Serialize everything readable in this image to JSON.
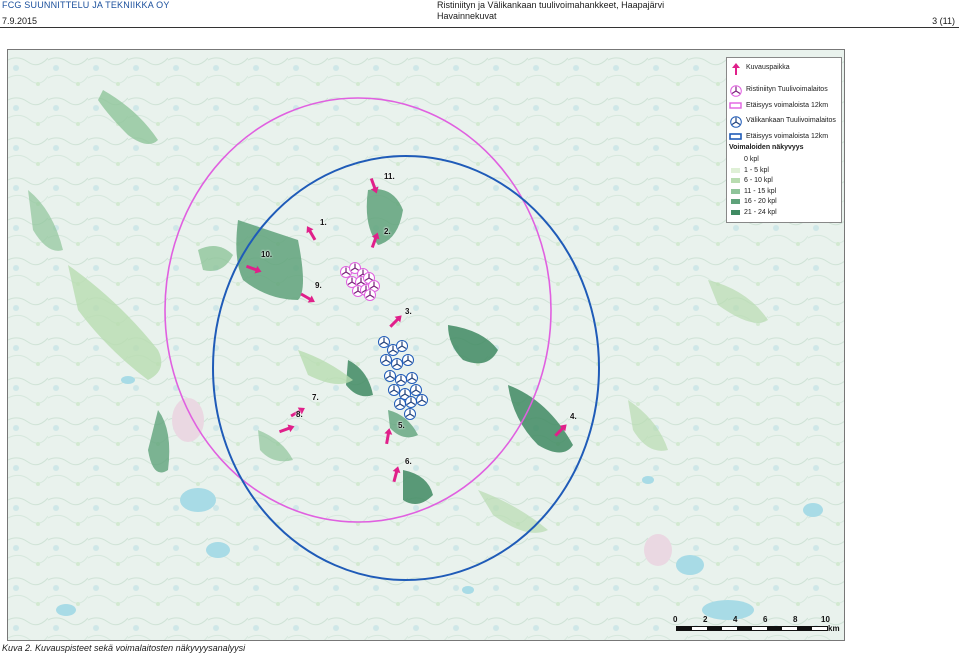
{
  "header": {
    "company": "FCG SUUNNITTELU JA TEKNIIKKA OY",
    "date": "7.9.2015",
    "title_line1": "Ristiniityn ja Välikankaan tuulivoimahankkeet, Haapajärvi",
    "title_line2": "Havainnekuvat",
    "page": "3 (11)"
  },
  "legend": {
    "photo_point": "Kuvauspaikka",
    "ristiniitty_turbine": "Ristiniityn Tuulivoimalaitos",
    "ristiniitty_distance": "Etäisyys voimaloista 12km",
    "valikangas_turbine": "Välikankaan Tuulivoimalaitos",
    "valikangas_distance": "Etäisyys voimaloista 12km",
    "visibility_title": "Voimaloiden näkyvyys",
    "classes": [
      {
        "label": "0 kpl",
        "color": "#ffffff"
      },
      {
        "label": "1 - 5 kpl",
        "color": "#dff0d6"
      },
      {
        "label": "6 - 10 kpl",
        "color": "#b8dcb0"
      },
      {
        "label": "11 - 15 kpl",
        "color": "#8fc49a"
      },
      {
        "label": "16 - 20 kpl",
        "color": "#5fa27a"
      },
      {
        "label": "21 - 24 kpl",
        "color": "#3f8a62"
      }
    ]
  },
  "colors": {
    "ristiniitty": "#e060e0",
    "valikangas": "#1f5bb8",
    "arrow": "#e0208a",
    "map_base": "#e8f1ec",
    "water": "#a8dbe6"
  },
  "photo_points": [
    "1.",
    "2.",
    "3.",
    "4.",
    "5.",
    "6.",
    "7.",
    "8.",
    "9.",
    "10.",
    "11."
  ],
  "scale_bar": {
    "ticks": [
      "0",
      "2",
      "4",
      "6",
      "8",
      "10"
    ],
    "unit": "km"
  },
  "caption": "Kuva 2. Kuvauspisteet sekä voimalaitosten näkyvyysanalyysi"
}
